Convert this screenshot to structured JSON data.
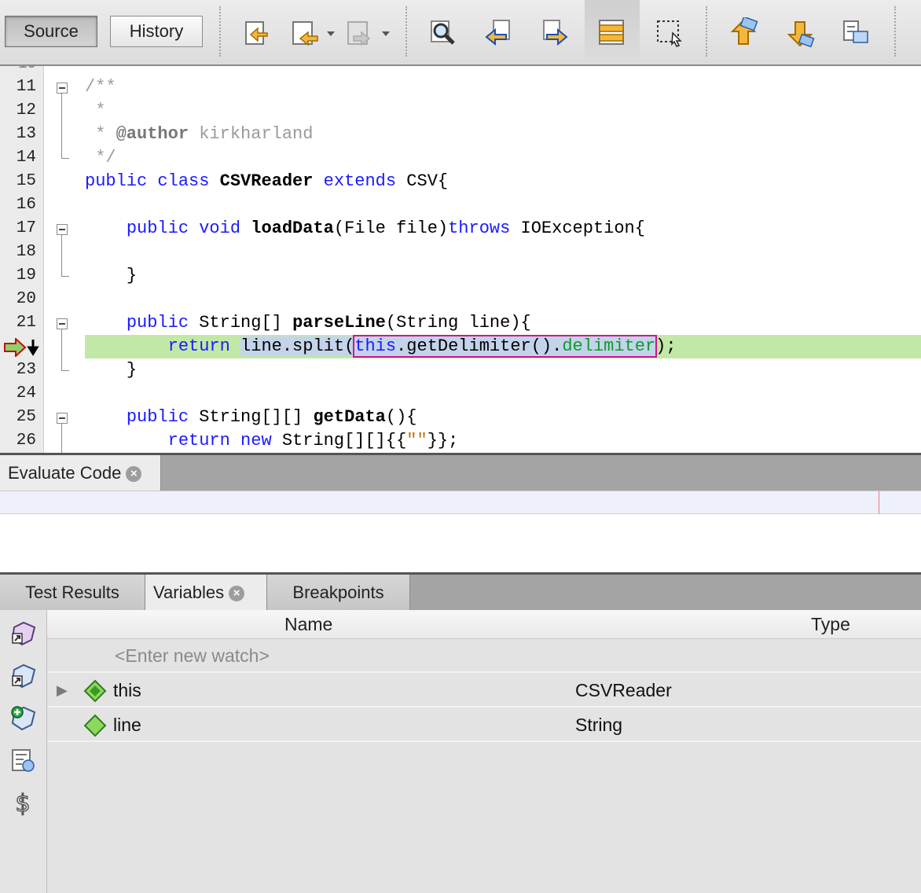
{
  "toolbar": {
    "source_label": "Source",
    "history_label": "History"
  },
  "editor": {
    "line_numbers": [
      "11",
      "12",
      "13",
      "14",
      "15",
      "16",
      "17",
      "18",
      "19",
      "20",
      "21",
      "22",
      "23",
      "24",
      "25",
      "26"
    ],
    "comment_open": "/**",
    "comment_star": "*",
    "comment_author_tag": "@author",
    "comment_author_name": "kirkharland",
    "comment_close": "*/",
    "class_decl": {
      "kw1": "public",
      "kw2": "class",
      "name": "CSVReader",
      "kw3": "extends",
      "parent": "CSV{"
    },
    "load_decl": {
      "kw1": "public",
      "kw2": "void",
      "name": "loadData",
      "params": "(File file)",
      "kw3": "throws",
      "exc": "IOException{"
    },
    "close_brace": "}",
    "parse_decl": {
      "kw1": "public",
      "type": "String[]",
      "name": "parseLine",
      "params": "(String line){"
    },
    "return_line": {
      "kw": "return",
      "pre": "line.split(",
      "this_kw": "this",
      "call": ".getDelimiter().",
      "field": "delimiter",
      "post": ");"
    },
    "get_decl": {
      "kw1": "public",
      "type": "String[][]",
      "name": "getData",
      "params": "(){"
    },
    "return_new": {
      "kw1": "return",
      "kw2": "new",
      "pre": "String[][]{{",
      "str": "\"\"",
      "post": "}};"
    }
  },
  "eval_panel": {
    "tab_label": "Evaluate Code",
    "close_glyph": "×"
  },
  "bottom_panel": {
    "tabs": [
      {
        "label": "Test Results"
      },
      {
        "label": "Variables"
      },
      {
        "label": "Breakpoints"
      }
    ],
    "close_glyph": "×",
    "columns": {
      "name": "Name",
      "type": "Type"
    },
    "watch_placeholder": "<Enter new watch>",
    "rows": [
      {
        "name": "this",
        "type": "CSVReader",
        "expand": "▶"
      },
      {
        "name": "line",
        "type": "String"
      }
    ]
  },
  "colors": {
    "keyword": "#1a1aff",
    "current_line": "#c2e8a8",
    "selection": "#c3d3ea",
    "eval_box": "#d0158f",
    "field": "#0c9c2c"
  }
}
